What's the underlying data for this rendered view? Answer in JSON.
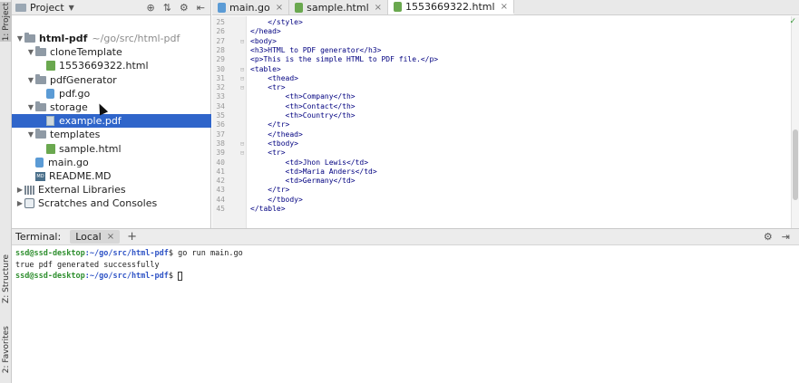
{
  "left_strip": {
    "project_tab": "1: Project",
    "structure_tab": "Z: Structure",
    "favorites_tab": "2: Favorites"
  },
  "project_panel": {
    "title": "Project",
    "tree": [
      {
        "label": "html-pdf",
        "extra": "~/go/src/html-pdf",
        "type": "folder",
        "depth": 0,
        "expanded": true
      },
      {
        "label": "cloneTemplate",
        "type": "folder",
        "depth": 1,
        "expanded": true
      },
      {
        "label": "1553669322.html",
        "type": "html",
        "depth": 2
      },
      {
        "label": "pdfGenerator",
        "type": "folder",
        "depth": 1,
        "expanded": true
      },
      {
        "label": "pdf.go",
        "type": "go",
        "depth": 2
      },
      {
        "label": "storage",
        "type": "folder",
        "depth": 1,
        "expanded": true
      },
      {
        "label": "example.pdf",
        "type": "pdf",
        "depth": 2,
        "selected": true
      },
      {
        "label": "templates",
        "type": "folder",
        "depth": 1,
        "expanded": true
      },
      {
        "label": "sample.html",
        "type": "html",
        "depth": 2
      },
      {
        "label": "main.go",
        "type": "go",
        "depth": 1
      },
      {
        "label": "README.MD",
        "type": "md",
        "depth": 1
      },
      {
        "label": "External Libraries",
        "type": "lib",
        "depth": 0,
        "expanded": false
      },
      {
        "label": "Scratches and Consoles",
        "type": "scratch",
        "depth": 0,
        "expanded": false
      }
    ]
  },
  "editor": {
    "tabs": [
      {
        "label": "main.go",
        "icon": "go-file-icon",
        "active": false
      },
      {
        "label": "sample.html",
        "icon": "html-file-icon",
        "active": false
      },
      {
        "label": "1553669322.html",
        "icon": "html-file-icon",
        "active": true
      }
    ],
    "lines": [
      {
        "n": "25",
        "text": "    </style>"
      },
      {
        "n": "26",
        "text": "</head>"
      },
      {
        "n": "27",
        "text": "<body>"
      },
      {
        "n": "28",
        "text": "<h3>HTML to PDF generator</h3>"
      },
      {
        "n": "29",
        "text": "<p>This is the simple HTML to PDF file.</p>"
      },
      {
        "n": "30",
        "text": "<table>"
      },
      {
        "n": "31",
        "text": "    <thead>"
      },
      {
        "n": "32",
        "text": "    <tr>"
      },
      {
        "n": "33",
        "text": "        <th>Company</th>"
      },
      {
        "n": "34",
        "text": "        <th>Contact</th>"
      },
      {
        "n": "35",
        "text": "        <th>Country</th>"
      },
      {
        "n": "36",
        "text": "    </tr>"
      },
      {
        "n": "37",
        "text": "    </thead>"
      },
      {
        "n": "38",
        "text": "    <tbody>"
      },
      {
        "n": "39",
        "text": "    <tr>"
      },
      {
        "n": "40",
        "text": "        <td>Jhon Lewis</td>"
      },
      {
        "n": "41",
        "text": "        <td>Maria Anders</td>"
      },
      {
        "n": "42",
        "text": "        <td>Germany</td>"
      },
      {
        "n": "43",
        "text": "    </tr>"
      },
      {
        "n": "44",
        "text": "    </tbody>"
      },
      {
        "n": "45",
        "text": "</table>"
      }
    ]
  },
  "terminal": {
    "title": "Terminal:",
    "tab_label": "Local",
    "lines": [
      {
        "user": "ssd@ssd-desktop",
        "path": ":~/go/src/html-pdf",
        "cmd": "$ go run main.go"
      },
      {
        "output": "true pdf generated successfully"
      },
      {
        "user": "ssd@ssd-desktop",
        "path": ":~/go/src/html-pdf",
        "cmd": "$ "
      }
    ]
  },
  "colors": {
    "selection": "#2f65ca",
    "prompt_user": "#2f8f2f",
    "prompt_path": "#2f54c6",
    "html_tag": "#000080"
  }
}
